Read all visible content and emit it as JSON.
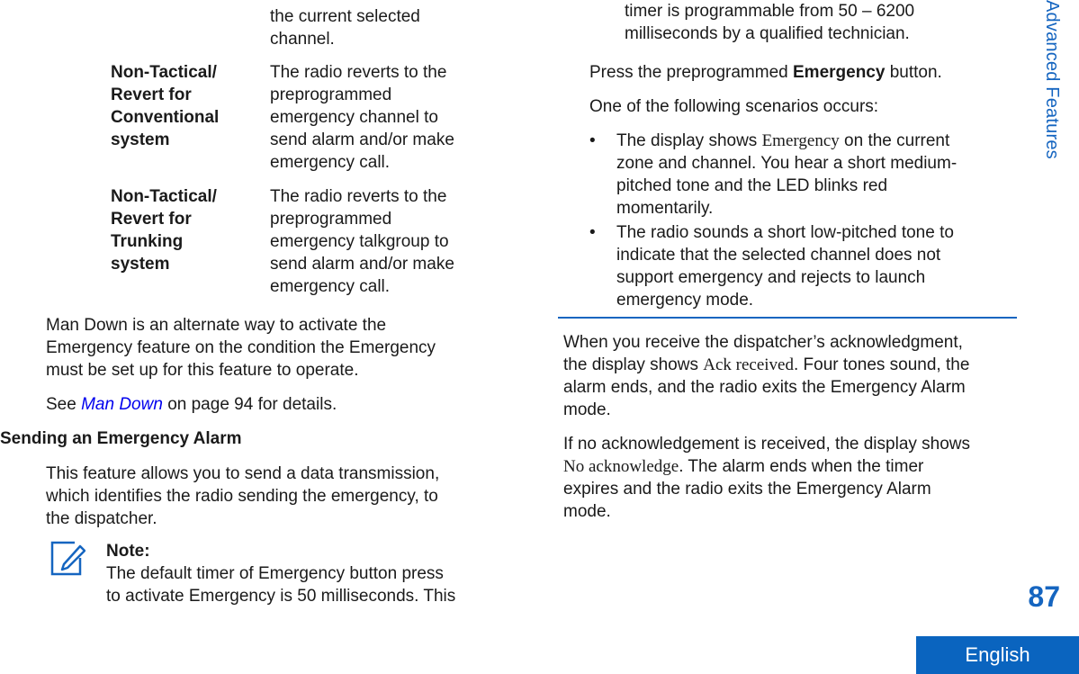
{
  "table": {
    "continuation": [
      "the current selected",
      "channel."
    ],
    "rows": [
      {
        "term": [
          "Non-Tactical/",
          "Revert for",
          "Conventional",
          "system"
        ],
        "desc": [
          "The radio reverts to the",
          "preprogrammed",
          "emergency channel to",
          "send alarm and/or make",
          "emergency call."
        ]
      },
      {
        "term": [
          "Non-Tactical/",
          "Revert for",
          "Trunking",
          "system"
        ],
        "desc": [
          "The radio reverts to the",
          "preprogrammed",
          "emergency talkgroup to",
          "send alarm and/or make",
          "emergency call."
        ]
      }
    ]
  },
  "man_down": {
    "para": [
      "Man Down is an alternate way to activate the",
      "Emergency feature on the condition the Emergency",
      "must be set up for this feature to operate."
    ],
    "see_prefix": "See ",
    "see_link": "Man Down",
    "see_suffix": " on page 94 for details."
  },
  "section": {
    "heading": "Sending an Emergency Alarm",
    "intro": [
      "This feature allows you to send a data transmission,",
      "which identifies the radio sending the emergency, to",
      "the dispatcher."
    ]
  },
  "note": {
    "icon": "note-pencil-icon",
    "title": "Note:",
    "lines": [
      "The default timer of Emergency button press",
      "to activate Emergency is 50 milliseconds. This",
      "timer is programmable from 50 – 6200",
      "milliseconds by a qualified technician."
    ]
  },
  "steps": {
    "press_prefix": "Press the preprogrammed ",
    "press_bold": "Emergency",
    "press_suffix": " button.",
    "scenarios_intro": "One of the following scenarios occurs:",
    "bullet_glyph": "•",
    "bullets": [
      {
        "l1_prefix": "The display shows ",
        "l1_display": "Emergency",
        "l1_suffix": " on the current",
        "rest": [
          "zone and channel. You hear a short medium-",
          "pitched tone and the LED blinks red",
          "momentarily."
        ]
      },
      {
        "lines": [
          "The radio sounds a short low-pitched tone to",
          "indicate that the selected channel does not",
          "support emergency and rejects to launch",
          "emergency mode."
        ]
      }
    ]
  },
  "result": {
    "ack_l1": "When you receive the dispatcher’s acknowledgment,",
    "ack_l2_prefix": "the display shows ",
    "ack_l2_display": "Ack received",
    "ack_l2_suffix": ". Four tones sound, the",
    "ack_l3": "alarm ends, and the radio exits the Emergency Alarm",
    "ack_l4": "mode.",
    "noack_l1": "If no acknowledgement is received, the display shows",
    "noack_l2_display": "No acknowledge",
    "noack_l2_suffix": ". The alarm ends when the timer",
    "noack_l3": "expires and the radio exits the Emergency Alarm",
    "noack_l4": "mode."
  },
  "page": {
    "side_tab": "Advanced Features",
    "number": "87",
    "language": "English",
    "accent_color": "#1565c0"
  }
}
